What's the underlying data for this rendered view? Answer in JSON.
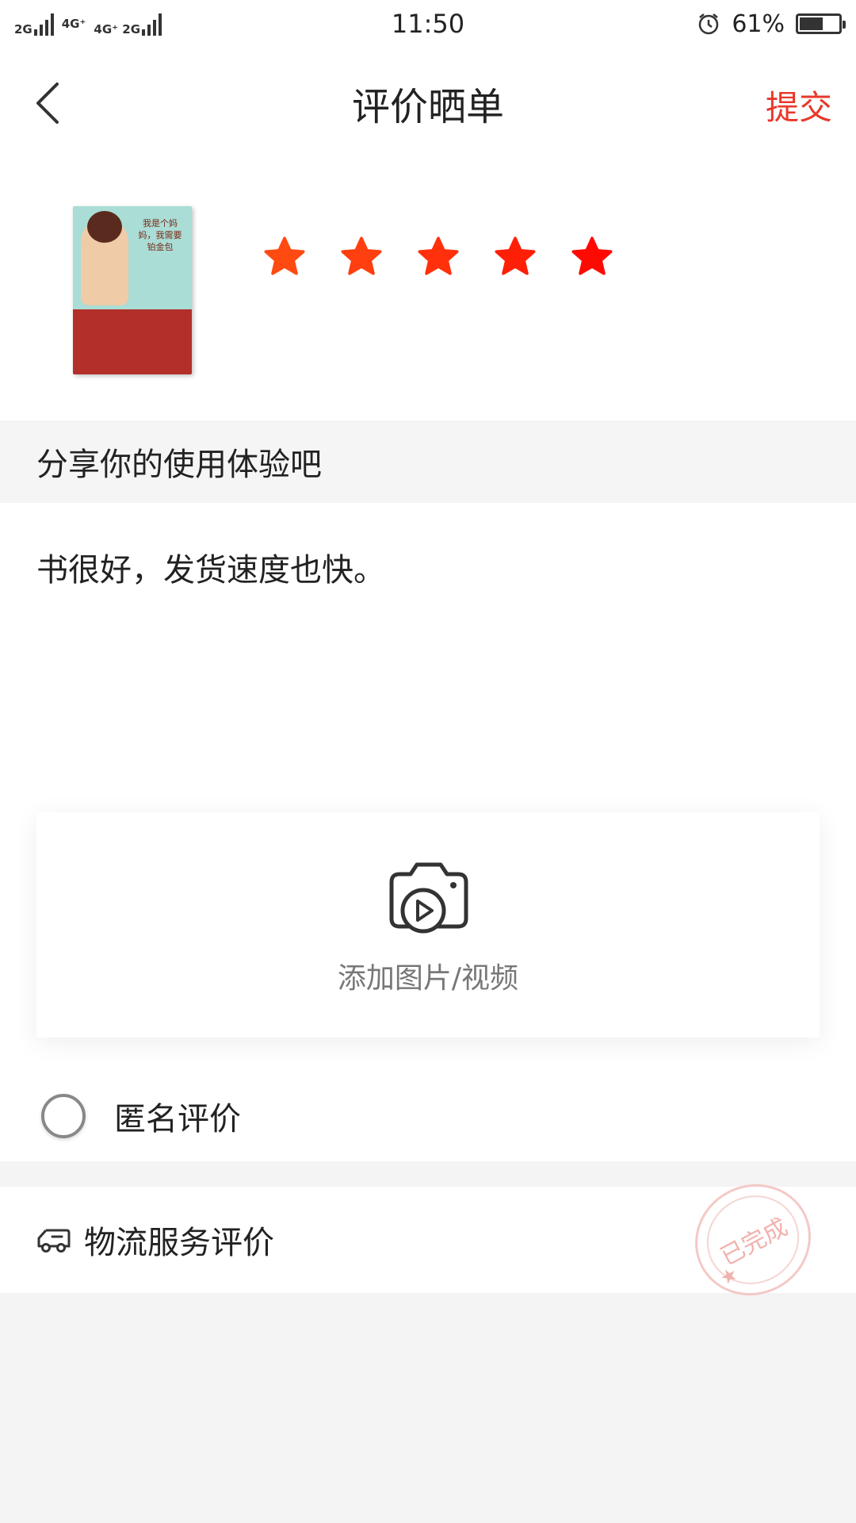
{
  "status_bar": {
    "left_networks": [
      "2G",
      "4G⁺",
      "4G⁺ 2G"
    ],
    "time": "11:50",
    "battery_percent": "61%",
    "battery_level": 0.61
  },
  "header": {
    "title": "评价晒单",
    "submit_label": "提交"
  },
  "product": {
    "cover_title": "我是个妈妈，我需要铂金包",
    "rating": 5,
    "max_rating": 5,
    "star_colors": [
      "#ff4a12",
      "#ff3f10",
      "#ff300b",
      "#ff1f07",
      "#ff0a03"
    ]
  },
  "share": {
    "prompt": "分享你的使用体验吧",
    "review_text": "书很好，发货速度也快。"
  },
  "upload": {
    "label": "添加图片/视频"
  },
  "anonymous": {
    "label": "匿名评价",
    "checked": false
  },
  "logistics": {
    "label": "物流服务评价",
    "stamp_text": "已完成"
  },
  "colors": {
    "accent": "#e8382b",
    "background": "#f4f4f4"
  }
}
